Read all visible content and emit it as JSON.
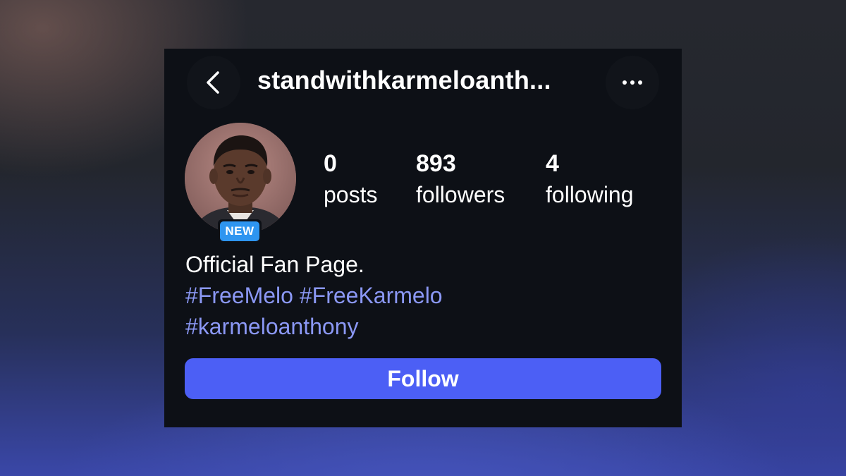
{
  "header": {
    "username": "standwithkarmeloanth...",
    "back_icon": "chevron-left-icon",
    "more_icon": "ellipsis-horizontal-icon"
  },
  "profile": {
    "avatar": "profile-photo",
    "badge": "NEW",
    "stats": [
      {
        "value": "0",
        "label": "posts"
      },
      {
        "value": "893",
        "label": "followers"
      },
      {
        "value": "4",
        "label": "following"
      }
    ],
    "bio": {
      "line1": "Official Fan Page.",
      "hashtags": [
        "#FreeMelo",
        "#FreeKarmelo",
        "#karmeloanthony"
      ]
    }
  },
  "actions": {
    "follow_label": "Follow"
  },
  "colors": {
    "card_bg": "#0d1016",
    "accent": "#4c5ff5",
    "badge": "#2e95f0",
    "hashtag": "#8b98f5",
    "text": "#ffffff"
  }
}
